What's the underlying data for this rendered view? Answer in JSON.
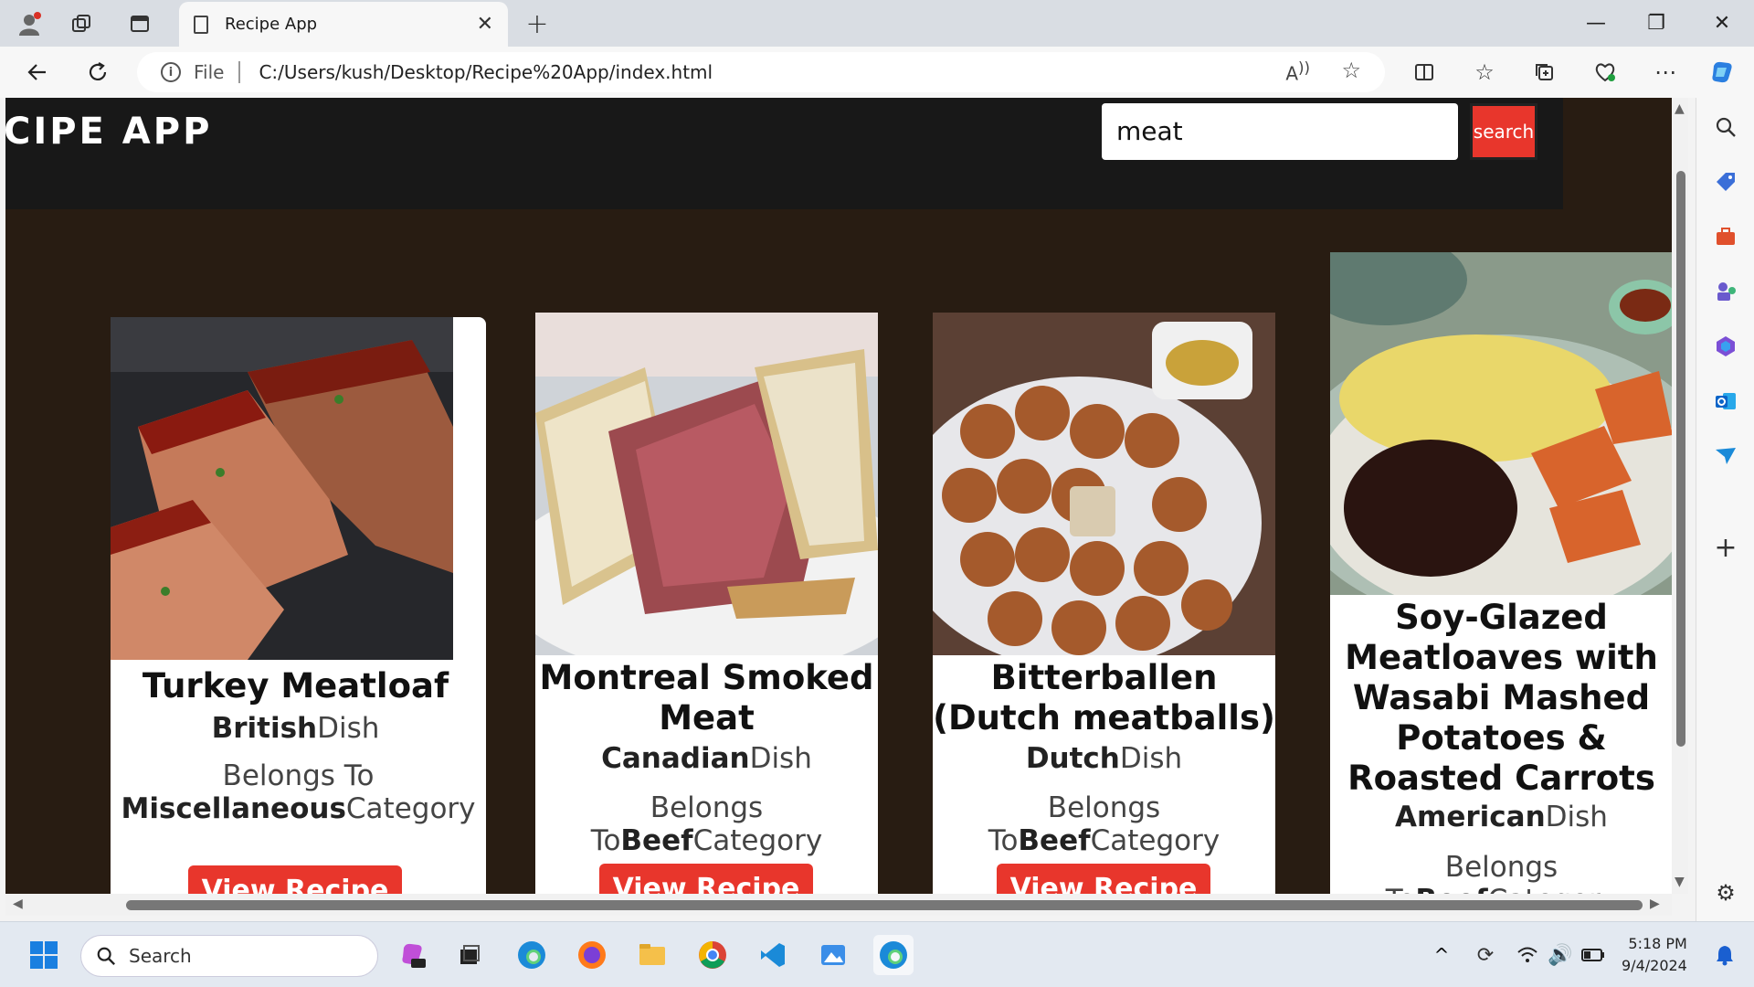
{
  "browser": {
    "tab_title": "Recipe App",
    "address_prefix": "File",
    "url": "C:/Users/kush/Desktop/Recipe%20App/index.html"
  },
  "app": {
    "brand": "CIPE APP",
    "search_value": "meat",
    "search_button": "search"
  },
  "cards": [
    {
      "title": "Turkey Meatloaf",
      "area": "British",
      "area_suffix": "Dish",
      "belongs": "Belongs To",
      "category": "Miscellaneous",
      "category_suffix": "Category",
      "button": "View Recipe"
    },
    {
      "title": "Montreal Smoked Meat",
      "area": "Canadian",
      "area_suffix": "Dish",
      "belongs": "Belongs To",
      "category": "Beef",
      "category_suffix": "Category",
      "button": "View Recipe"
    },
    {
      "title": "Bitterballen (Dutch meatballs)",
      "area": "Dutch",
      "area_suffix": "Dish",
      "belongs": "Belongs To",
      "category": "Beef",
      "category_suffix": "Category",
      "button": "View Recipe"
    },
    {
      "title": "Soy-Glazed Meatloaves with Wasabi Mashed Potatoes & Roasted Carrots",
      "area": "American",
      "area_suffix": "Dish",
      "belongs": "Belongs To",
      "category": "Beef",
      "category_suffix": "Category"
    }
  ],
  "taskbar": {
    "search_label": "Search",
    "time": "5:18 PM",
    "date": "9/4/2024"
  },
  "colors": {
    "page_bg": "#281c12",
    "header_bg": "#181818",
    "accent_red": "#e8362c"
  }
}
